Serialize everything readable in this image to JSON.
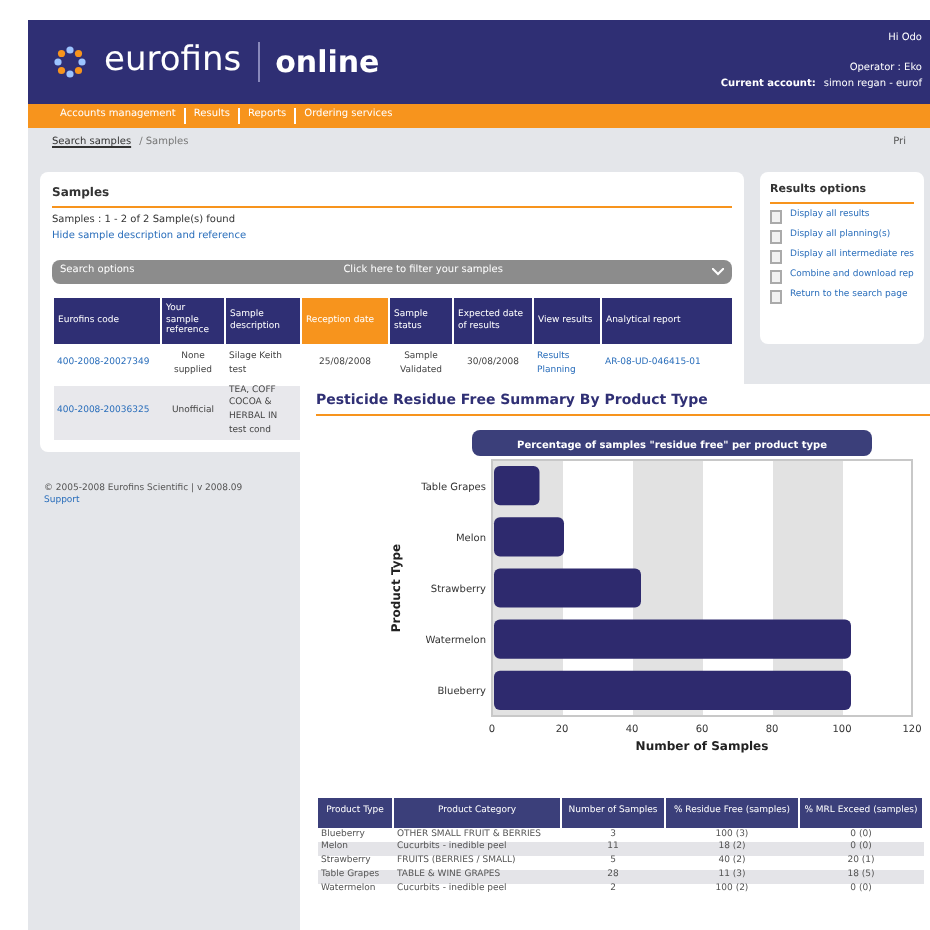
{
  "header": {
    "logo": "eurofins",
    "product": "online",
    "greeting": "Hi Odo",
    "operator": "Operator : Eko",
    "account_label": "Current account:",
    "account": "simon regan - eurof"
  },
  "nav": [
    "Accounts management",
    "Results",
    "Reports",
    "Ordering services"
  ],
  "breadcrumb": {
    "link": "Search samples",
    "current": "/ Samples",
    "print": "Pri"
  },
  "samples": {
    "title": "Samples",
    "count": "Samples : 1 - 2 of 2 Sample(s) found",
    "toggle": "Hide sample description and reference",
    "search_bar": {
      "label": "Search options",
      "hint": "Click here to filter your samples"
    },
    "columns": [
      {
        "label": "Eurofins code",
        "selected": false
      },
      {
        "label": "Your sample reference",
        "selected": false
      },
      {
        "label": "Sample description",
        "selected": false
      },
      {
        "label": "Reception date",
        "selected": true
      },
      {
        "label": "Sample status",
        "selected": false
      },
      {
        "label": "Expected date of results",
        "selected": false
      },
      {
        "label": "View results",
        "selected": false
      },
      {
        "label": "Analytical report",
        "selected": false
      }
    ],
    "rows": [
      [
        "400-2008-20027349",
        "None supplied",
        "Silage Keith test",
        "25/08/2008",
        "Sample Validated",
        "30/08/2008",
        [
          "Results",
          "Planning"
        ],
        "AR-08-UD-046415-01"
      ],
      [
        "400-2008-20036325",
        "Unofficial",
        "TEA, COFF COCOA & HERBAL IN test cond"
      ]
    ]
  },
  "footer": {
    "copyright": "© 2005-2008 Eurofins Scientific | v 2008.09",
    "link": "Support"
  },
  "results_options": {
    "title": "Results options",
    "items": [
      "Display all results",
      "Display all planning(s)",
      "Display all intermediate res",
      "Combine and download rep",
      "Return to the search page"
    ]
  },
  "summary": {
    "title": "Pesticide Residue Free Summary By Product Type",
    "chart_data": {
      "type": "bar",
      "orientation": "horizontal",
      "title": "Percentage of samples \"residue free\" per product type",
      "xlabel": "Number of Samples",
      "ylabel": "Product Type",
      "categories": [
        "Table Grapes",
        "Melon",
        "Strawberry",
        "Watermelon",
        "Blueberry"
      ],
      "series": [
        {
          "color": "#2e2a6e",
          "values": [
            13,
            20,
            42,
            102,
            102
          ]
        }
      ],
      "xlim": [
        0,
        120
      ],
      "xticks": [
        0,
        20,
        40,
        60,
        80,
        100,
        120
      ]
    },
    "table": {
      "columns": [
        "Product Type",
        "Product Category",
        "Number of Samples",
        "% Residue Free (samples)",
        "% MRL Exceed (samples)"
      ],
      "rows": [
        [
          "Blueberry",
          "OTHER SMALL FRUIT & BERRIES",
          "3",
          "100 (3)",
          "0 (0)"
        ],
        [
          "Melon",
          "Cucurbits - inedible peel",
          "11",
          "18 (2)",
          "0 (0)"
        ],
        [
          "Strawberry",
          "FRUITS (BERRIES / SMALL)",
          "5",
          "40 (2)",
          "20 (1)"
        ],
        [
          "Table Grapes",
          "TABLE & WINE GRAPES",
          "28",
          "11 (3)",
          "18 (5)"
        ],
        [
          "Watermelon",
          "Cucurbits - inedible peel",
          "2",
          "100 (2)",
          "0 (0)"
        ]
      ]
    }
  }
}
